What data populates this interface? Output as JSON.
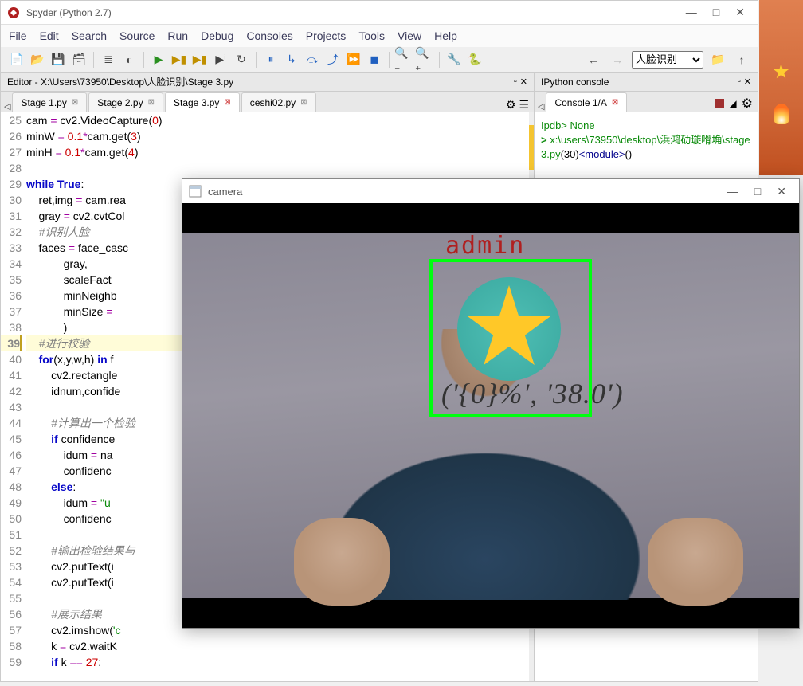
{
  "window": {
    "title": "Spyder (Python 2.7)",
    "minimize": "—",
    "maximize": "□",
    "close": "✕"
  },
  "menu": {
    "file": "File",
    "edit": "Edit",
    "search": "Search",
    "source": "Source",
    "run": "Run",
    "debug": "Debug",
    "consoles": "Consoles",
    "projects": "Projects",
    "tools": "Tools",
    "view": "View",
    "help": "Help"
  },
  "toolbar": {
    "working_dir": "人脸识别"
  },
  "editor": {
    "header": "Editor - X:\\Users\\73950\\Desktop\\人脸识别\\Stage 3.py",
    "tabs": [
      {
        "label": "Stage 1.py",
        "active": false,
        "modified": false
      },
      {
        "label": "Stage 2.py",
        "active": false,
        "modified": false
      },
      {
        "label": "Stage 3.py",
        "active": true,
        "modified": true
      },
      {
        "label": "ceshi02.py",
        "active": false,
        "modified": false
      }
    ],
    "lines": [
      {
        "n": 25,
        "html": "cam <span class='op'>=</span> cv2.VideoCapture(<span class='num'>0</span>)"
      },
      {
        "n": 26,
        "html": "minW <span class='op'>=</span> <span class='num'>0.1</span><span class='op'>*</span>cam.get(<span class='num'>3</span>)"
      },
      {
        "n": 27,
        "html": "minH <span class='op'>=</span> <span class='num'>0.1</span><span class='op'>*</span>cam.get(<span class='num'>4</span>)"
      },
      {
        "n": 28,
        "html": ""
      },
      {
        "n": 29,
        "html": "<span class='kw'>while</span> <span class='kw'>True</span>:"
      },
      {
        "n": 30,
        "html": "    ret,img <span class='op'>=</span> cam.rea"
      },
      {
        "n": 31,
        "html": "    gray <span class='op'>=</span> cv2.cvtCol"
      },
      {
        "n": 32,
        "html": "    <span class='com'>#识别人脸</span>"
      },
      {
        "n": 33,
        "html": "    faces <span class='op'>=</span> face_casc"
      },
      {
        "n": 34,
        "html": "            gray,"
      },
      {
        "n": 35,
        "html": "            scaleFact"
      },
      {
        "n": 36,
        "html": "            minNeighb"
      },
      {
        "n": 37,
        "html": "            minSize <span class='op'>=</span>"
      },
      {
        "n": 38,
        "html": "            )"
      },
      {
        "n": 39,
        "html": "    <span class='com'>#进行校验</span>",
        "current": true
      },
      {
        "n": 40,
        "html": "    <span class='kw'>for</span>(x,y,w,h) <span class='kw'>in</span> f"
      },
      {
        "n": 41,
        "html": "        cv2.rectangle"
      },
      {
        "n": 42,
        "html": "        idnum,confide"
      },
      {
        "n": 43,
        "html": ""
      },
      {
        "n": 44,
        "html": "        <span class='com'>#计算出一个检验</span>"
      },
      {
        "n": 45,
        "html": "        <span class='kw'>if</span> confidence"
      },
      {
        "n": 46,
        "html": "            idum <span class='op'>=</span> na"
      },
      {
        "n": 47,
        "html": "            confidenc"
      },
      {
        "n": 48,
        "html": "        <span class='kw'>else</span>:"
      },
      {
        "n": 49,
        "html": "            idum <span class='op'>=</span> <span class='str'>\"u</span>"
      },
      {
        "n": 50,
        "html": "            confidenc"
      },
      {
        "n": 51,
        "html": ""
      },
      {
        "n": 52,
        "html": "        <span class='com'>#输出检验结果与</span>"
      },
      {
        "n": 53,
        "html": "        cv2.putText(i"
      },
      {
        "n": 54,
        "html": "        cv2.putText(i"
      },
      {
        "n": 55,
        "html": ""
      },
      {
        "n": 56,
        "html": "        <span class='com'>#展示结果</span>"
      },
      {
        "n": 57,
        "html": "        cv2.imshow(<span class='str'>'c</span>"
      },
      {
        "n": 58,
        "html": "        k <span class='op'>=</span> cv2.waitK"
      },
      {
        "n": 59,
        "html": "        <span class='kw'>if</span> k <span class='op'>==</span> <span class='num'>27</span>:"
      }
    ]
  },
  "console": {
    "header": "IPython console",
    "tab": "Console 1/A",
    "line0": "Ipdb> None",
    "line1_prefix": "> ",
    "line1": "x:\\users\\73950\\desktop\\浜鸿劯璇嗗埆\\stage ",
    "line2a": "3.py",
    "line2b": "(30)",
    "line2c": "<module>",
    "line2d": "()"
  },
  "camera": {
    "title": "camera",
    "label": "admin",
    "confidence": "('{0}%', '38.0')"
  }
}
